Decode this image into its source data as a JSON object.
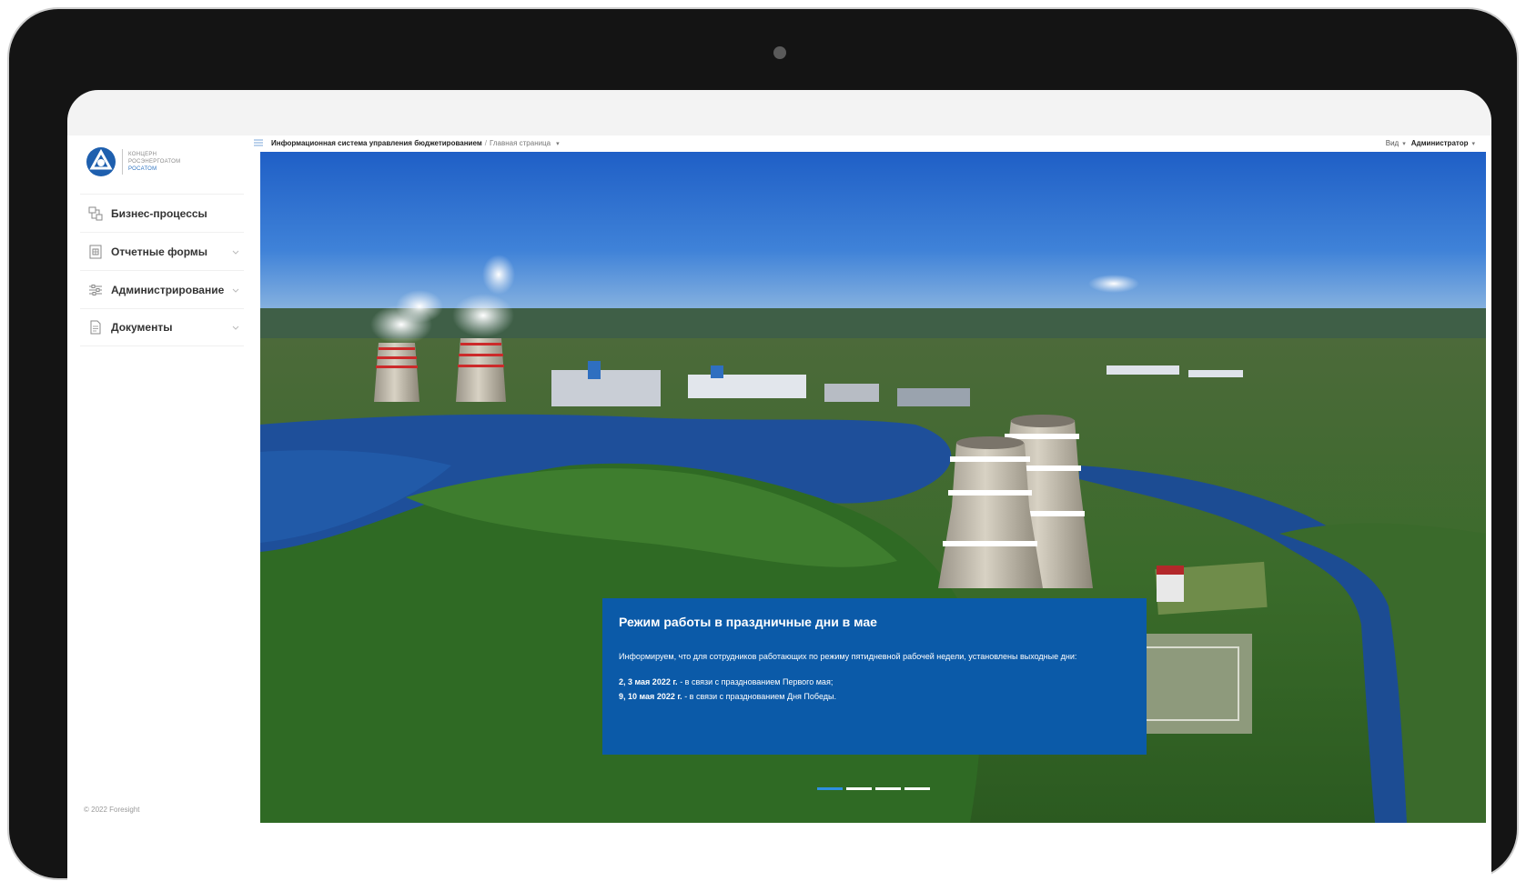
{
  "sidebar": {
    "logo": {
      "line1": "КОНЦЕРН",
      "line2": "РОСЭНЕРГОАТОМ",
      "line3": "РОСАТОМ"
    },
    "items": [
      {
        "label": "Бизнес-процессы",
        "icon": "process-icon",
        "expandable": false
      },
      {
        "label": "Отчетные формы",
        "icon": "report-forms-icon",
        "expandable": true
      },
      {
        "label": "Администрирование",
        "icon": "admin-settings-icon",
        "expandable": true
      },
      {
        "label": "Документы",
        "icon": "document-icon",
        "expandable": true
      }
    ],
    "copyright": "© 2022 Foresight"
  },
  "header": {
    "app_name": "Информационная система управления бюджетированием",
    "separator": "/",
    "page": "Главная страница",
    "view_label": "Вид",
    "user": "Администратор"
  },
  "news": {
    "title": "Режим работы в праздничные дни в мае",
    "text": "Информируем, что для сотрудников работающих по режиму пятидневной рабочей недели, установлены выходные дни:",
    "lines": [
      {
        "date": "2, 3 мая 2022 г.",
        "desc": " - в связи с празднованием Первого мая;"
      },
      {
        "date": "9, 10 мая 2022 г.",
        "desc": " - в связи с празднованием Дня Победы."
      }
    ]
  },
  "slider": {
    "count": 4,
    "active_index": 0
  },
  "colors": {
    "card": "#0b5aa8",
    "accent": "#2f8fe0",
    "bezel": "#141414"
  }
}
